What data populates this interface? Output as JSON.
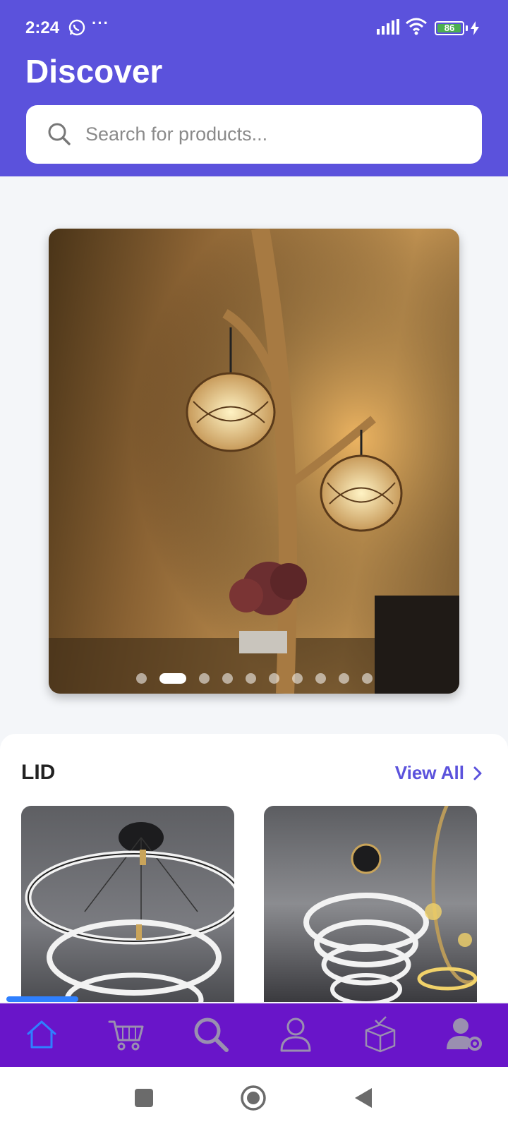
{
  "status_bar": {
    "time": "2:24",
    "battery": "86",
    "icons": [
      "whatsapp-icon",
      "more-dots-icon",
      "signal-icon",
      "wifi-icon",
      "battery-icon",
      "charging-icon"
    ]
  },
  "header": {
    "title": "Discover",
    "background_color": "#5b52dc"
  },
  "search": {
    "placeholder": "Search for products..."
  },
  "carousel": {
    "slide_count": 10,
    "active_index": 1
  },
  "section": {
    "title": "LID",
    "view_all_label": "View All"
  },
  "products": [
    {
      "name": "ring-chandelier-1"
    },
    {
      "name": "ring-chandelier-2"
    }
  ],
  "tab_bar": {
    "background_color": "#6915c9",
    "active_color": "#2f80ff",
    "items": [
      {
        "icon": "home-icon",
        "active": true
      },
      {
        "icon": "cart-icon",
        "active": false
      },
      {
        "icon": "search-icon",
        "active": false
      },
      {
        "icon": "user-icon",
        "active": false
      },
      {
        "icon": "package-icon",
        "active": false
      },
      {
        "icon": "user-settings-icon",
        "active": false
      }
    ]
  },
  "system_nav": {
    "items": [
      "recents-button",
      "home-button",
      "back-button"
    ]
  }
}
